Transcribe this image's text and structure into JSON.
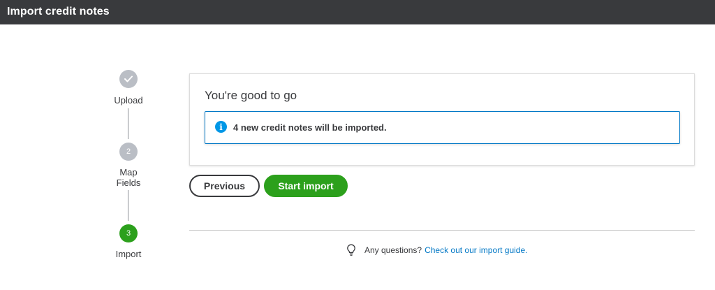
{
  "header": {
    "title": "Import credit notes"
  },
  "stepper": {
    "steps": [
      {
        "number": "1",
        "label": "Upload",
        "state": "done",
        "icon": "check-icon"
      },
      {
        "number": "2",
        "label_line1": "Map",
        "label_line2": "Fields",
        "state": "pending"
      },
      {
        "number": "3",
        "label": "Import",
        "state": "active"
      }
    ]
  },
  "card": {
    "title": "You're good to go",
    "info": {
      "icon": "info-icon",
      "text": "4 new credit notes will be imported."
    }
  },
  "buttons": {
    "previous": "Previous",
    "start_import": "Start import"
  },
  "help": {
    "icon": "lightbulb-icon",
    "text": "Any questions?",
    "link": "Check out our import guide."
  },
  "colors": {
    "accent_green": "#2ca01c",
    "link_blue": "#0077c5",
    "header_bg": "#393a3d",
    "step_inactive": "#babec5"
  }
}
